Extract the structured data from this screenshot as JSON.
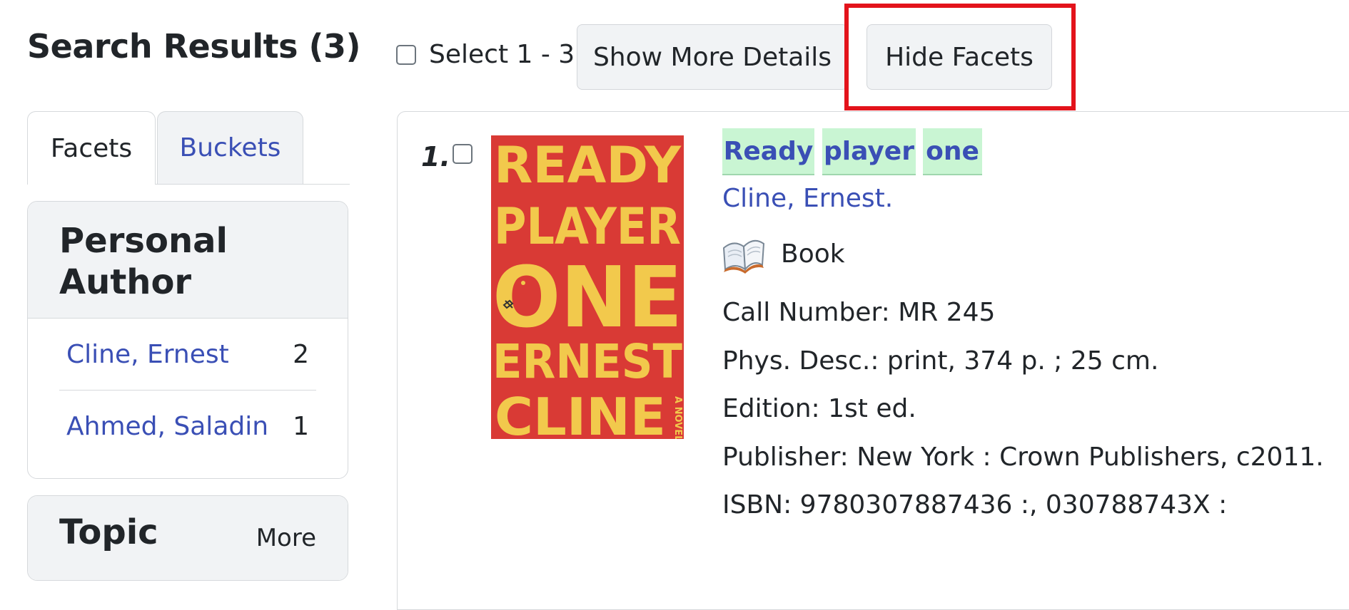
{
  "header": {
    "title": "Search Results (3)",
    "select_label": "Select 1 - 3",
    "show_more_label": "Show More Details",
    "hide_facets_label": "Hide Facets"
  },
  "sidebar": {
    "tabs": [
      {
        "label": "Facets",
        "active": true
      },
      {
        "label": "Buckets",
        "active": false
      }
    ],
    "facet_groups": [
      {
        "title": "Personal Author",
        "items": [
          {
            "label": "Cline, Ernest",
            "count": "2"
          },
          {
            "label": "Ahmed, Saladin",
            "count": "1"
          }
        ]
      },
      {
        "title": "Topic",
        "more_label": "More"
      }
    ]
  },
  "results": [
    {
      "number": "1.",
      "cover_text": [
        "READY",
        "PLAYER",
        "ONE",
        "ERNEST",
        "CLINE"
      ],
      "cover_side_text": "A NOVEL",
      "title_words": [
        "Ready",
        "player",
        "one"
      ],
      "author": "Cline, Ernest.",
      "format": "Book",
      "format_icon": "open-book-icon",
      "details": [
        "Call Number: MR 245",
        "Phys. Desc.: print, 374 p. ; 25 cm.",
        "Edition: 1st ed.",
        "Publisher: New York : Crown Publishers, c2011.",
        "ISBN: 9780307887436 :, 030788743X :"
      ]
    }
  ],
  "colors": {
    "link": "#3a4fb5",
    "highlight_border": "#e3131b",
    "tag_bg": "#c9f5d3",
    "cover_bg": "#d93a35",
    "cover_text": "#f2c94c"
  }
}
